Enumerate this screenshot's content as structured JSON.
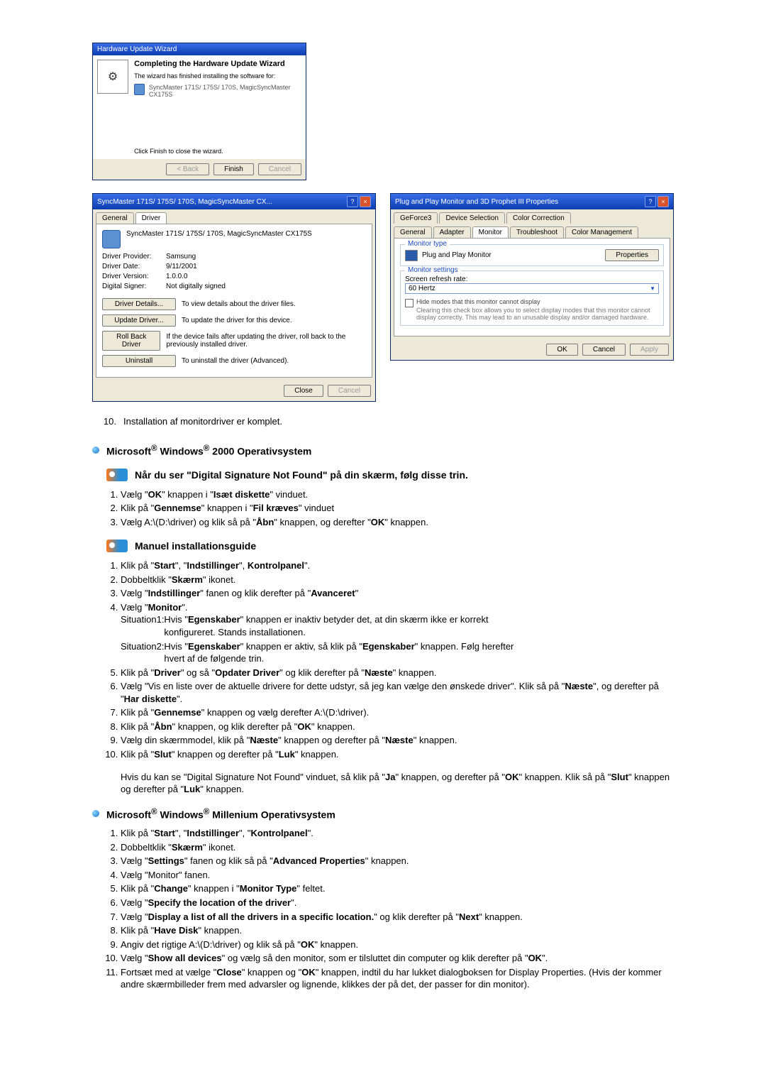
{
  "wizard": {
    "title": "Hardware Update Wizard",
    "heading": "Completing the Hardware Update Wizard",
    "line1": "The wizard has finished installing the software for:",
    "device": "SyncMaster 171S/ 175S/ 170S, MagicSyncMaster CX175S",
    "finish_hint": "Click Finish to close the wizard.",
    "back": "< Back",
    "finish": "Finish",
    "cancel": "Cancel"
  },
  "driver": {
    "title": "SyncMaster 171S/ 175S/ 170S, MagicSyncMaster CX...",
    "tab_general": "General",
    "tab_driver": "Driver",
    "device": "SyncMaster 171S/ 175S/ 170S, MagicSyncMaster CX175S",
    "provider_k": "Driver Provider:",
    "provider_v": "Samsung",
    "date_k": "Driver Date:",
    "date_v": "9/11/2001",
    "version_k": "Driver Version:",
    "version_v": "1.0.0.0",
    "signer_k": "Digital Signer:",
    "signer_v": "Not digitally signed",
    "details_btn": "Driver Details...",
    "details_txt": "To view details about the driver files.",
    "update_btn": "Update Driver...",
    "update_txt": "To update the driver for this device.",
    "rollback_btn": "Roll Back Driver",
    "rollback_txt": "If the device fails after updating the driver, roll back to the previously installed driver.",
    "uninstall_btn": "Uninstall",
    "uninstall_txt": "To uninstall the driver (Advanced).",
    "close": "Close",
    "cancel": "Cancel"
  },
  "props": {
    "title": "Plug and Play Monitor and 3D Prophet III Properties",
    "tabs": {
      "gf": "GeForce3",
      "ds": "Device Selection",
      "cc": "Color Correction",
      "gen": "General",
      "ada": "Adapter",
      "mon": "Monitor",
      "tro": "Troubleshoot",
      "cm": "Color Management"
    },
    "mt_group": "Monitor type",
    "mt_val": "Plug and Play Monitor",
    "props_btn": "Properties",
    "ms_group": "Monitor settings",
    "rr_lbl": "Screen refresh rate:",
    "rr_val": "60 Hertz",
    "hide": "Hide modes that this monitor cannot display",
    "hide_desc": "Clearing this check box allows you to select display modes that this monitor cannot display correctly. This may lead to an unusable display and/or damaged hardware.",
    "ok": "OK",
    "cancel": "Cancel",
    "apply": "Apply"
  },
  "body": {
    "step10": "Installation af monitordriver er komplet.",
    "h_2000_a": "Microsoft",
    "h_2000_b": " Windows",
    "h_2000_c": " 2000 Operativsystem",
    "sig_h": "Når du ser \"Digital Signature Not Found\" på din skærm, følg disse trin.",
    "sig_1": "Vælg \"OK\" knappen i \"Isæt diskette\" vinduet.",
    "sig_2": "Klik på \"Gennemse\" knappen i \"Fil kræves\" vinduet",
    "sig_3": "Vælg A:\\(D:\\driver) og klik så på \"Åbn\" knappen, og derefter \"OK\" knappen.",
    "man_h": "Manuel installationsguide",
    "m1": "Klik på \"Start\", \"Indstillinger\", Kontrolpanel\".",
    "m2": "Dobbeltklik \"Skærm\" ikonet.",
    "m3": "Vælg \"Indstillinger\" fanen og klik derefter på \"Avanceret\"",
    "m4": "Vælg \"Monitor\".",
    "m4s1": "Situation1:Hvis \"Egenskaber\" knappen er inaktiv betyder det, at din skærm ikke er korrekt konfigureret. Stands installationen.",
    "m4s2": "Situation2:Hvis \"Egenskaber\" knappen er aktiv, så klik på \"Egenskaber\" knappen. Følg herefter hvert af de følgende trin.",
    "m5": "Klik på \"Driver\" og så \"Opdater Driver\" og klik derefter på \"Næste\" knappen.",
    "m6": "Vælg \"Vis en liste over de aktuelle drivere for dette udstyr, så jeg kan vælge den ønskede driver\". Klik så på \"Næste\", og derefter på \"Har diskette\".",
    "m7": "Klik på \"Gennemse\" knappen og vælg derefter A:\\(D:\\driver).",
    "m8": "Klik på \"Åbn\" knappen, og klik derefter på \"OK\" knappen.",
    "m9": "Vælg din skærmmodel, klik på \"Næste\" knappen og derefter på \"Næste\" knappen.",
    "m10": "Klik på \"Slut\" knappen og derefter på \"Luk\" knappen.",
    "m_par": "Hvis du kan se \"Digital Signature Not Found\" vinduet, så klik på \"Ja\" knappen, og derefter på \"OK\" knappen. Klik så på \"Slut\" knappen og derefter på \"Luk\" knappen.",
    "h_me_a": "Microsoft",
    "h_me_b": " Windows",
    "h_me_c": " Millenium Operativsystem",
    "me1": "Klik på \"Start\", \"Indstillinger\", \"Kontrolpanel\".",
    "me2": "Dobbeltklik \"Skærm\" ikonet.",
    "me3": "Vælg \"Settings\" fanen og klik så på \"Advanced Properties\" knappen.",
    "me4": "Vælg \"Monitor\" fanen.",
    "me5": "Klik på \"Change\" knappen i \"Monitor Type\" feltet.",
    "me6": "Vælg \"Specify the location of the driver\".",
    "me7": "Vælg \"Display a list of all the drivers in a specific location.\" og klik derefter på \"Next\" knappen.",
    "me8": "Klik på \"Have Disk\" knappen.",
    "me9": "Angiv det rigtige A:\\(D:\\driver) og klik så på \"OK\" knappen.",
    "me10": "Vælg \"Show all devices\" og vælg så den monitor, som er tilsluttet din computer og klik derefter på \"OK\".",
    "me11": "Fortsæt med at vælge \"Close\" knappen og \"OK\" knappen, indtil du har lukket dialogboksen for Display Properties. (Hvis der kommer andre skærmbilleder frem med advarsler og lignende, klikkes der på det, der passer for din monitor)."
  }
}
